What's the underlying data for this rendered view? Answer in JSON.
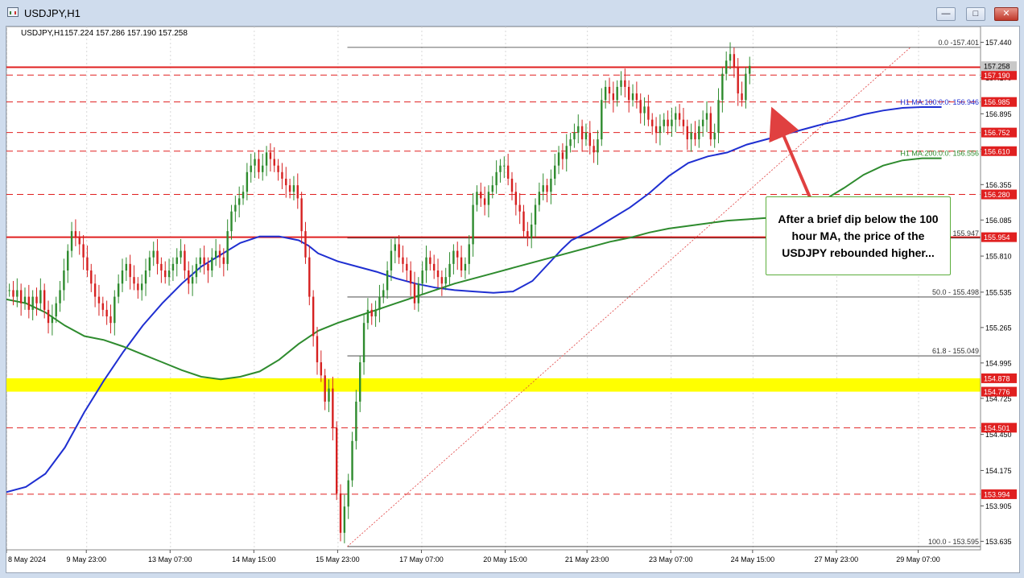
{
  "window": {
    "title": "USDJPY,H1",
    "minimize_icon": "minimize-icon",
    "maximize_icon": "maximize-icon",
    "close_icon": "close-icon"
  },
  "header": {
    "symbol": "USDJPY,H1",
    "ohlc": "157.224 157.286 157.190 157.258"
  },
  "annotation": {
    "text": "After a brief dip below the 100 hour MA, the price of the USDJPY rebounded higher..."
  },
  "colors": {
    "background": "#ffffff",
    "bull_candle": "#2e8b2e",
    "bear_candle": "#d62020",
    "ma100": "#1f2fd1",
    "ma200": "#2e8b2e",
    "level_line": "#e02020",
    "highlight_zone": "#ffff00",
    "annotation_border": "#5cae3d",
    "arrow": "#e04040"
  },
  "chart_data": {
    "type": "candlestick",
    "symbol": "USDJPY",
    "timeframe": "H1",
    "ylim": [
      153.57,
      157.56
    ],
    "xlim": [
      0,
      1000
    ],
    "y_ticks": [
      157.44,
      157.17,
      156.895,
      156.625,
      156.355,
      156.085,
      155.81,
      155.535,
      155.265,
      154.995,
      154.725,
      154.45,
      154.175,
      153.905,
      153.635
    ],
    "y_tick_labels": [
      "157.440",
      "157.170",
      "156.895",
      "156.625",
      "156.355",
      "156.085",
      "155.810",
      "155.535",
      "155.265",
      "154.995",
      "154.725",
      "154.450",
      "154.175",
      "153.905",
      "153.635"
    ],
    "x_ticks": [
      0,
      82,
      168,
      254,
      340,
      426,
      512,
      596,
      682,
      766,
      852,
      936
    ],
    "x_tick_labels": [
      "8 May 2024",
      "9 May 23:00",
      "13 May 07:00",
      "14 May 15:00",
      "15 May 23:00",
      "17 May 07:00",
      "20 May 15:00",
      "21 May 23:00",
      "23 May 07:00",
      "24 May 15:00",
      "27 May 23:00",
      "29 May 07:00"
    ],
    "current_price": 157.258,
    "current_price_label": "157.258",
    "price_labels": [
      {
        "value": 157.19,
        "label": "157.190"
      },
      {
        "value": 156.985,
        "label": "156.985"
      },
      {
        "value": 156.752,
        "label": "156.752"
      },
      {
        "value": 156.61,
        "label": "156.610"
      },
      {
        "value": 156.28,
        "label": "156.280"
      },
      {
        "value": 155.954,
        "label": "155.954"
      },
      {
        "value": 154.878,
        "label": "154.878"
      },
      {
        "value": 154.776,
        "label": "154.776"
      },
      {
        "value": 154.501,
        "label": "154.501"
      },
      {
        "value": 153.994,
        "label": "153.994"
      }
    ],
    "support_resistance_solid": [
      157.25,
      155.954
    ],
    "support_resistance_dashed": [
      157.19,
      156.985,
      156.752,
      156.61,
      156.28,
      154.501,
      153.994
    ],
    "highlight_zone": [
      154.776,
      154.878
    ],
    "fibonacci": {
      "x_start": 350,
      "x_end": 1000,
      "levels": [
        {
          "value": 157.401,
          "label": "0.0 -157.401"
        },
        {
          "value": 155.947,
          "label": "155.947"
        },
        {
          "value": 155.498,
          "label": "50.0 - 155.498"
        },
        {
          "value": 155.049,
          "label": "61.8 - 155.049"
        },
        {
          "value": 153.595,
          "label": "100.0 - 153.595"
        }
      ],
      "trend_from": [
        350,
        153.595
      ],
      "trend_to": [
        928,
        157.401
      ]
    },
    "ma_labels": [
      {
        "label": "H1 MA:100:0:0: 156.946",
        "value": 156.946
      },
      {
        "label": "H1 MA:200:0:0: 156.556",
        "value": 156.556
      }
    ],
    "series": [
      {
        "name": "H1 MA:100:0:0",
        "x": [
          0,
          20,
          40,
          60,
          80,
          100,
          120,
          140,
          160,
          180,
          200,
          220,
          240,
          260,
          280,
          300,
          310,
          320,
          340,
          360,
          380,
          400,
          420,
          440,
          460,
          480,
          500,
          520,
          540,
          560,
          570,
          580,
          600,
          620,
          640,
          660,
          680,
          700,
          720,
          740,
          760,
          780,
          800,
          820,
          840,
          860,
          880,
          900,
          920,
          940,
          960
        ],
        "values": [
          154.01,
          154.05,
          154.15,
          154.35,
          154.62,
          154.86,
          155.08,
          155.28,
          155.45,
          155.6,
          155.73,
          155.82,
          155.91,
          155.96,
          155.96,
          155.93,
          155.89,
          155.83,
          155.77,
          155.73,
          155.69,
          155.64,
          155.6,
          155.57,
          155.55,
          155.54,
          155.53,
          155.54,
          155.62,
          155.78,
          155.86,
          155.93,
          156.0,
          156.09,
          156.18,
          156.29,
          156.42,
          156.52,
          156.57,
          156.6,
          156.66,
          156.7,
          156.74,
          156.78,
          156.82,
          156.85,
          156.89,
          156.92,
          156.94,
          156.946,
          156.946
        ]
      },
      {
        "name": "H1 MA:200:0:0",
        "x": [
          0,
          20,
          40,
          60,
          80,
          100,
          120,
          140,
          160,
          180,
          200,
          220,
          230,
          240,
          260,
          280,
          300,
          320,
          340,
          360,
          380,
          400,
          420,
          440,
          460,
          480,
          500,
          520,
          540,
          560,
          580,
          600,
          620,
          640,
          660,
          680,
          700,
          720,
          740,
          760,
          780,
          800,
          820,
          840,
          860,
          880,
          900,
          920,
          940,
          960
        ],
        "values": [
          155.48,
          155.45,
          155.38,
          155.28,
          155.2,
          155.17,
          155.12,
          155.06,
          155.0,
          154.94,
          154.89,
          154.87,
          154.88,
          154.89,
          154.93,
          155.02,
          155.14,
          155.24,
          155.3,
          155.35,
          155.4,
          155.45,
          155.5,
          155.55,
          155.6,
          155.64,
          155.68,
          155.72,
          155.76,
          155.8,
          155.84,
          155.88,
          155.92,
          155.95,
          155.99,
          156.02,
          156.04,
          156.06,
          156.08,
          156.09,
          156.1,
          156.13,
          156.17,
          156.24,
          156.33,
          156.43,
          156.5,
          156.54,
          156.556,
          156.556
        ]
      }
    ],
    "candles": {
      "x_start": 3,
      "x_step": 4,
      "close": [
        155.55,
        155.5,
        155.55,
        155.45,
        155.5,
        155.4,
        155.5,
        155.45,
        155.55,
        155.4,
        155.3,
        155.35,
        155.45,
        155.55,
        155.7,
        155.85,
        156.0,
        155.95,
        155.9,
        155.8,
        155.7,
        155.6,
        155.5,
        155.45,
        155.4,
        155.35,
        155.3,
        155.5,
        155.6,
        155.7,
        155.75,
        155.65,
        155.6,
        155.55,
        155.6,
        155.7,
        155.8,
        155.85,
        155.75,
        155.7,
        155.65,
        155.7,
        155.75,
        155.8,
        155.85,
        155.7,
        155.6,
        155.65,
        155.75,
        155.8,
        155.75,
        155.7,
        155.8,
        155.85,
        155.8,
        155.75,
        156.0,
        156.15,
        156.2,
        156.25,
        156.3,
        156.45,
        156.5,
        156.55,
        156.45,
        156.5,
        156.6,
        156.55,
        156.5,
        156.45,
        156.4,
        156.35,
        156.3,
        156.35,
        156.25,
        156.0,
        155.8,
        155.5,
        155.2,
        155.0,
        154.9,
        154.7,
        154.8,
        154.5,
        154.0,
        153.7,
        153.9,
        154.1,
        154.4,
        154.7,
        155.0,
        155.3,
        155.4,
        155.35,
        155.4,
        155.5,
        155.55,
        155.7,
        155.85,
        155.9,
        155.8,
        155.75,
        155.7,
        155.6,
        155.45,
        155.6,
        155.7,
        155.8,
        155.75,
        155.7,
        155.65,
        155.6,
        155.65,
        155.75,
        155.85,
        155.8,
        155.7,
        155.75,
        155.9,
        156.2,
        156.3,
        156.25,
        156.2,
        156.3,
        156.35,
        156.45,
        156.5,
        156.5,
        156.4,
        156.3,
        156.2,
        156.15,
        156.0,
        155.95,
        156.05,
        156.2,
        156.3,
        156.35,
        156.3,
        156.4,
        156.5,
        156.6,
        156.55,
        156.65,
        156.7,
        156.75,
        156.8,
        156.7,
        156.75,
        156.65,
        156.6,
        156.7,
        157.0,
        157.1,
        157.05,
        157.0,
        157.1,
        157.15,
        157.1,
        157.0,
        157.05,
        157.0,
        156.9,
        156.95,
        156.85,
        156.8,
        156.75,
        156.8,
        156.85,
        156.8,
        156.85,
        156.9,
        156.85,
        156.8,
        156.7,
        156.75,
        156.7,
        156.8,
        156.85,
        156.9,
        156.7,
        156.75,
        157.0,
        157.2,
        157.3,
        157.35,
        157.25,
        157.05,
        157.0,
        157.2,
        157.26
      ]
    }
  }
}
